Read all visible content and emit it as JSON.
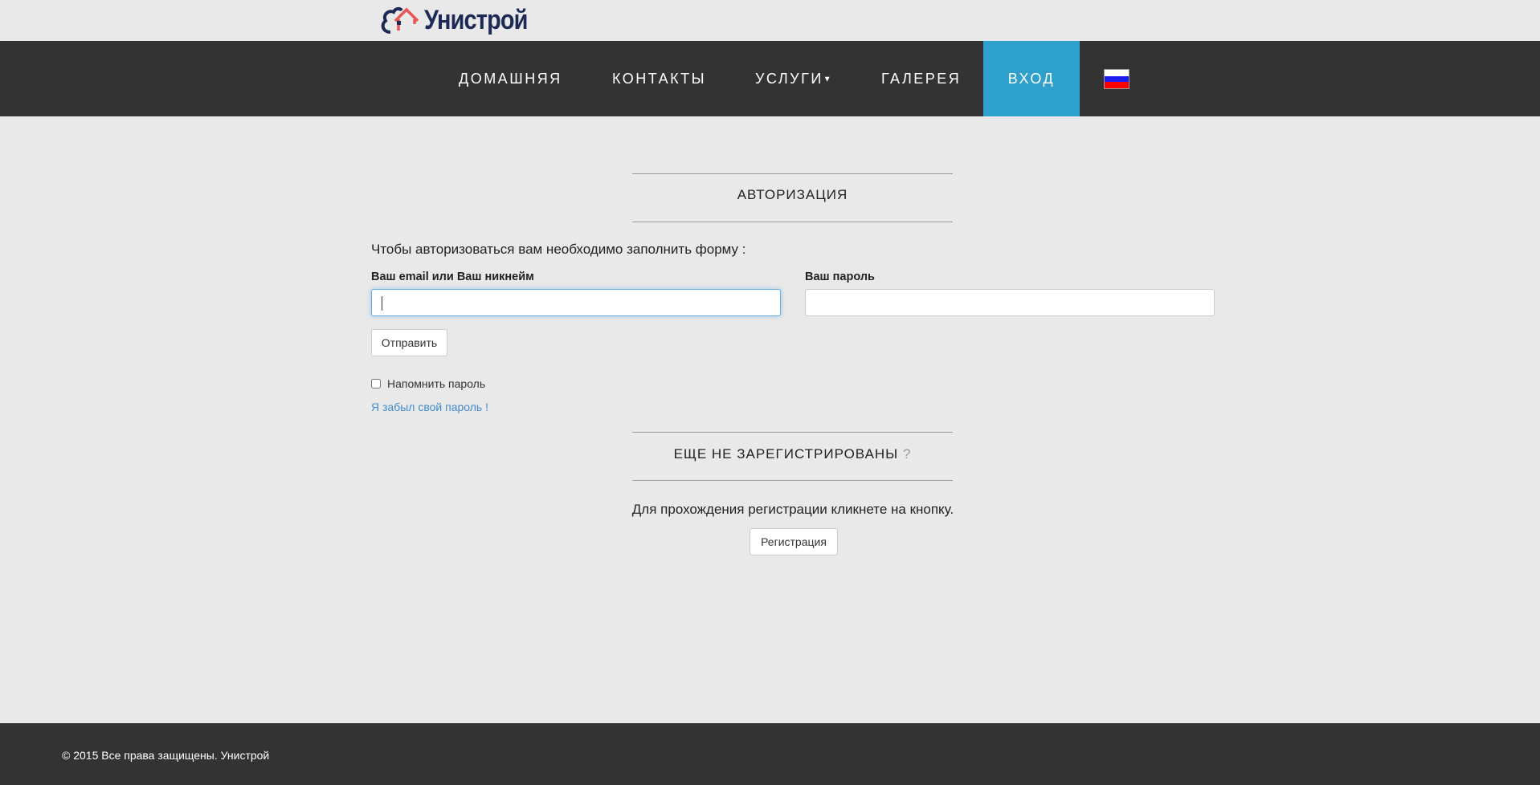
{
  "header": {
    "logo_text": "Унистрой"
  },
  "nav": {
    "items": [
      {
        "label": "ДОМАШНЯЯ"
      },
      {
        "label": "КОНТАКТЫ"
      },
      {
        "label": "УСЛУГИ"
      },
      {
        "label": "ГАЛЕРЕЯ"
      },
      {
        "label": "ВХОД"
      }
    ],
    "active": "ВХОД",
    "dropdown_caret": "▼"
  },
  "login": {
    "title": "АВТОРИЗАЦИЯ",
    "intro": "Чтобы авторизоваться вам необходимо заполнить форму :",
    "email_label": "Ваш email или Ваш никнейм",
    "email_value": "",
    "password_label": "Ваш пароль",
    "password_value": "",
    "submit_label": "Отправить",
    "remember_label": "Напомнить пароль",
    "remember_checked": false,
    "forgot_link": "Я забыл свой пароль !"
  },
  "register": {
    "title": "ЕЩЕ НЕ ЗАРЕГИСТРИРОВАНЫ",
    "title_mark": "?",
    "text": "Для прохождения регистрации кликнете на кнопку.",
    "button_label": "Регистрация"
  },
  "footer": {
    "copyright": "© 2015 Все права защищены. Унистрой"
  },
  "colors": {
    "nav_bg": "#333333",
    "active": "#2ea0cd",
    "link": "#428bca",
    "bg": "#e9e9e9"
  }
}
